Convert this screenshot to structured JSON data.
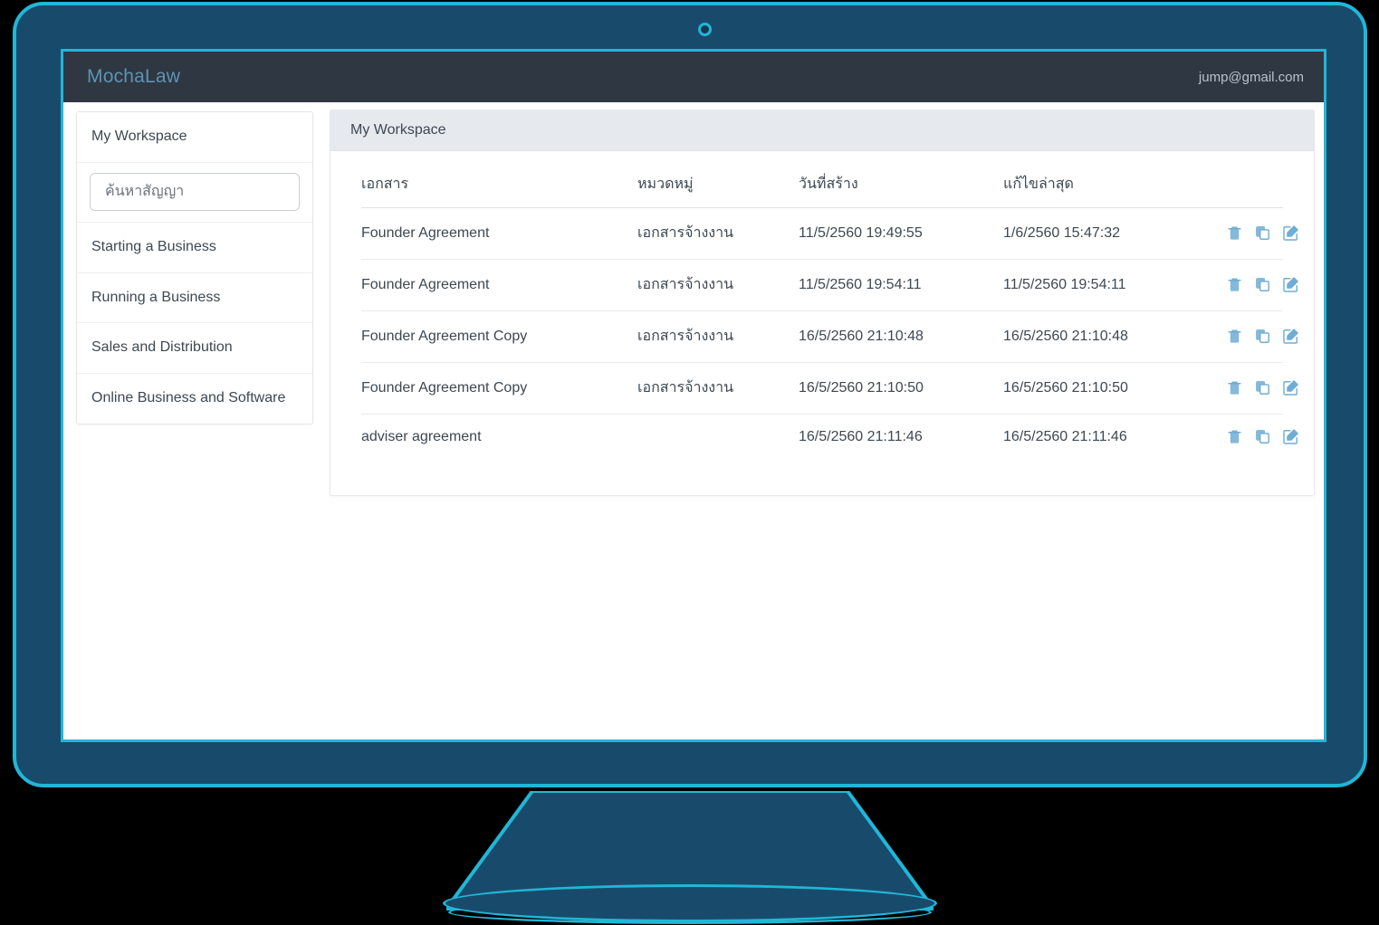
{
  "header": {
    "brand": "MochaLaw",
    "user_email": "jump@gmail.com",
    "bar_color": "#2f3742",
    "brand_color": "#5e93b3"
  },
  "device": {
    "frame_color": "#184b6b",
    "accent_color": "#21b6d8",
    "webcam_icon": "camera-dot-icon"
  },
  "sidebar": {
    "items": [
      {
        "label": "My Workspace"
      },
      {
        "label": "Starting a Business"
      },
      {
        "label": "Running a Business"
      },
      {
        "label": "Sales and Distribution"
      },
      {
        "label": "Online Business and Software"
      }
    ],
    "search": {
      "placeholder": "ค้นหาสัญญา",
      "value": ""
    }
  },
  "main": {
    "panel_title": "My Workspace",
    "table": {
      "columns": [
        {
          "key": "document",
          "label": "เอกสาร"
        },
        {
          "key": "category",
          "label": "หมวดหมู่"
        },
        {
          "key": "created",
          "label": "วันที่สร้าง"
        },
        {
          "key": "modified",
          "label": "แก้ไขล่าสุด"
        },
        {
          "key": "actions",
          "label": ""
        }
      ],
      "rows": [
        {
          "document": "Founder Agreement",
          "category": "เอกสารจ้างงาน",
          "created": "11/5/2560 19:49:55",
          "modified": "1/6/2560 15:47:32"
        },
        {
          "document": "Founder Agreement",
          "category": "เอกสารจ้างงาน",
          "created": "11/5/2560 19:54:11",
          "modified": "11/5/2560 19:54:11"
        },
        {
          "document": "Founder Agreement Copy",
          "category": "เอกสารจ้างงาน",
          "created": "16/5/2560 21:10:48",
          "modified": "16/5/2560 21:10:48"
        },
        {
          "document": "Founder Agreement Copy",
          "category": "เอกสารจ้างงาน",
          "created": "16/5/2560 21:10:50",
          "modified": "16/5/2560 21:10:50"
        },
        {
          "document": "adviser agreement",
          "category": "",
          "created": "16/5/2560 21:11:46",
          "modified": "16/5/2560 21:11:46"
        }
      ],
      "row_actions": [
        {
          "icon": "trash-icon",
          "title": "delete"
        },
        {
          "icon": "copy-icon",
          "title": "duplicate"
        },
        {
          "icon": "edit-icon",
          "title": "edit"
        }
      ],
      "action_icon_color": "#6fadd4"
    }
  }
}
